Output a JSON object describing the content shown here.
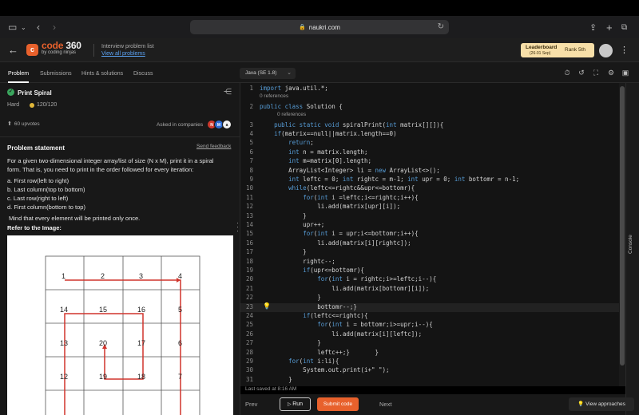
{
  "browser": {
    "url": "naukri.com"
  },
  "header": {
    "brand": "code",
    "brand_num": "360",
    "brand_sub": "by coding ninjas",
    "list_title": "Interview problem list",
    "list_link": "View all problems",
    "leaderboard_title": "Leaderboard",
    "leaderboard_dates": "(26-01 Sep)",
    "rank_label": "Rank",
    "rank_value": "5th"
  },
  "tabs": [
    {
      "label": "Problem",
      "active": true
    },
    {
      "label": "Submissions",
      "active": false
    },
    {
      "label": "Hints & solutions",
      "active": false
    },
    {
      "label": "Discuss",
      "active": false
    }
  ],
  "editor_toolbar": {
    "language": "Java (SE 1.8)"
  },
  "problem": {
    "title": "Print Spiral",
    "difficulty": "Hard",
    "score": "120/120",
    "upvotes": "60 upvotes",
    "asked_in": "Asked in companies",
    "statement_heading": "Problem statement",
    "feedback_link": "Send feedback",
    "description_1": "For a given two-dimensional integer array/list of size (N x M), print it in a spiral",
    "description_2": "form. That is, you need to print in the order followed for every iteration:",
    "rules": [
      "a. First row(left to right)",
      "b. Last column(top to bottom)",
      "c. Last row(right to left)",
      "d. First column(bottom to top)"
    ],
    "note": "Mind that every element will be printed only once.",
    "refer": "Refer to the Image:",
    "grid_numbers": [
      [
        "1",
        "2",
        "3",
        "4"
      ],
      [
        "14",
        "15",
        "16",
        "5"
      ],
      [
        "13",
        "20",
        "17",
        "6"
      ],
      [
        "12",
        "19",
        "18",
        "7"
      ]
    ]
  },
  "code": {
    "lines": [
      {
        "n": "1",
        "text": "import java.util.*;"
      },
      {
        "n": "2",
        "text": "public class Solution {"
      },
      {
        "n": "3",
        "text": "    public static void spiralPrint(int matrix[][]){"
      },
      {
        "n": "4",
        "text": "    if(matrix==null||matrix.length==0)"
      },
      {
        "n": "5",
        "text": "        return;"
      },
      {
        "n": "6",
        "text": "        int n = matrix.length;"
      },
      {
        "n": "7",
        "text": "        int m=matrix[0].length;"
      },
      {
        "n": "8",
        "text": "        ArrayList<Integer> li = new ArrayList<>();"
      },
      {
        "n": "9",
        "text": "        int leftc = 0; int rightc = m-1; int upr = 0; int bottomr = n-1;"
      },
      {
        "n": "10",
        "text": "        while(leftc<=rightc&&upr<=bottomr){"
      },
      {
        "n": "11",
        "text": "            for(int i =leftc;i<=rightc;i++){"
      },
      {
        "n": "12",
        "text": "                li.add(matrix[upr][i]);"
      },
      {
        "n": "13",
        "text": "            }"
      },
      {
        "n": "14",
        "text": "            upr++;"
      },
      {
        "n": "15",
        "text": "            for(int i = upr;i<=bottomr;i++){"
      },
      {
        "n": "16",
        "text": "                li.add(matrix[i][rightc]);"
      },
      {
        "n": "17",
        "text": "            }"
      },
      {
        "n": "18",
        "text": "            rightc--;"
      },
      {
        "n": "19",
        "text": "            if(upr<=bottomr){"
      },
      {
        "n": "20",
        "text": "                for(int i = rightc;i>=leftc;i--){"
      },
      {
        "n": "21",
        "text": "                    li.add(matrix[bottomr][i]);"
      },
      {
        "n": "22",
        "text": "                }"
      },
      {
        "n": "23",
        "text": "                bottomr--;}"
      },
      {
        "n": "24",
        "text": "            if(leftc<=rightc){"
      },
      {
        "n": "25",
        "text": "                for(int i = bottomr;i>=upr;i--){"
      },
      {
        "n": "26",
        "text": "                    li.add(matrix[i][leftc]);"
      },
      {
        "n": "27",
        "text": "                }"
      },
      {
        "n": "28",
        "text": "                leftc++;}       }"
      },
      {
        "n": "29",
        "text": "        for(int i:li){"
      },
      {
        "n": "30",
        "text": "            System.out.print(i+\" \");"
      },
      {
        "n": "31",
        "text": "        }"
      }
    ],
    "references": "0 references"
  },
  "footer": {
    "saved": "Last saved at 8:16 AM",
    "prev": "Prev",
    "run": "Run",
    "submit": "Submit code",
    "next": "Next",
    "approaches": "View approaches",
    "console": "Console"
  },
  "colors": {
    "accent": "#e8612c",
    "keyword": "#569cd6",
    "success": "#3aa55d"
  }
}
